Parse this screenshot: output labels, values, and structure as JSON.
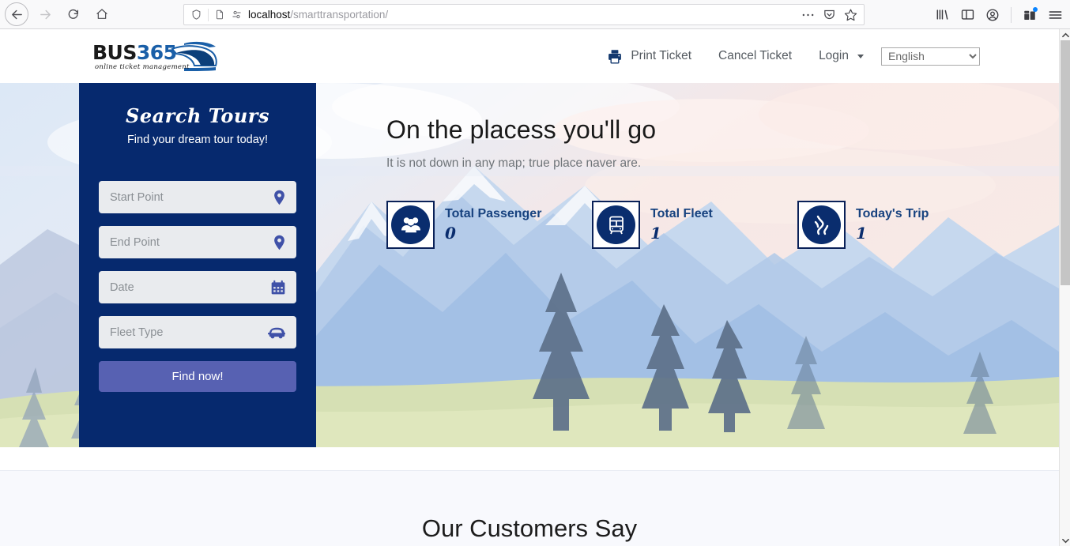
{
  "browser": {
    "url_host": "localhost",
    "url_path": "/smarttransportation/",
    "back_icon": "back-arrow-icon",
    "forward_icon": "forward-arrow-icon",
    "reload_icon": "reload-icon",
    "home_icon": "home-icon",
    "shield_icon": "shield-icon",
    "page_icon": "page-icon",
    "permissions_icon": "permissions-icon",
    "more_icon": "ellipsis-icon",
    "pocket_icon": "pocket-icon",
    "bookmark_icon": "star-icon",
    "library_icon": "library-icon",
    "sidebar_icon": "sidebar-icon",
    "account_icon": "account-icon",
    "extensions_icon": "extensions-icon",
    "menu_icon": "hamburger-menu-icon"
  },
  "site": {
    "logo": {
      "word_primary": "BUS",
      "word_accent": "365",
      "tagline": "online ticket management"
    },
    "nav": {
      "print_ticket": "Print Ticket",
      "cancel_ticket": "Cancel Ticket",
      "login": "Login",
      "language_selected": "English",
      "language_options": [
        "English"
      ]
    }
  },
  "search_panel": {
    "title": "Search Tours",
    "subtitle": "Find your dream tour today!",
    "fields": [
      {
        "placeholder": "Start Point",
        "icon": "map-pin-icon",
        "value": ""
      },
      {
        "placeholder": "End Point",
        "icon": "map-pin-icon",
        "value": ""
      },
      {
        "placeholder": "Date",
        "icon": "calendar-icon",
        "value": ""
      },
      {
        "placeholder": "Fleet Type",
        "icon": "vehicle-icon",
        "value": ""
      }
    ],
    "submit_label": "Find now!"
  },
  "hero": {
    "title": "On the placess you'll go",
    "subtitle": "It is not down in any map; true place naver are.",
    "stats": [
      {
        "label": "Total Passenger",
        "value": "0",
        "icon": "passengers-icon"
      },
      {
        "label": "Total Fleet",
        "value": "1",
        "icon": "bus-icon"
      },
      {
        "label": "Today's Trip",
        "value": "1",
        "icon": "road-icon"
      }
    ]
  },
  "testimonials": {
    "title": "Our Customers Say"
  },
  "colors": {
    "brand_navy": "#06296e",
    "brand_blue": "#17427f",
    "accent_button": "#5761b2",
    "logo_accent": "#1a5fa8",
    "section_bg": "#f8f9fd"
  }
}
